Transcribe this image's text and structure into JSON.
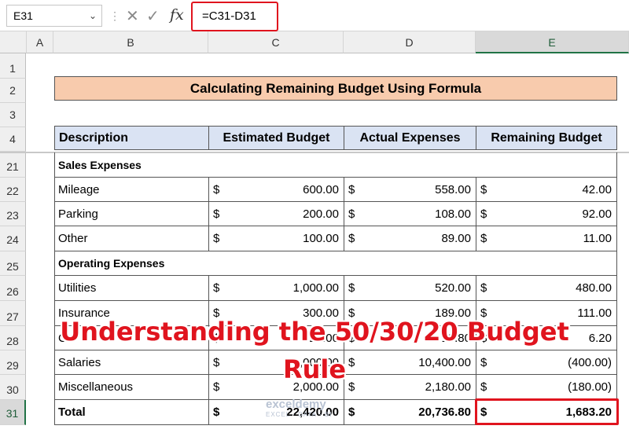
{
  "formula_bar": {
    "name_box": "E31",
    "formula": "=C31-D31",
    "fx_label": "fx"
  },
  "columns": [
    "A",
    "B",
    "C",
    "D",
    "E"
  ],
  "row_numbers": [
    "1",
    "2",
    "3",
    "4",
    "21",
    "22",
    "23",
    "24",
    "25",
    "26",
    "27",
    "28",
    "29",
    "30",
    "31"
  ],
  "sheet": {
    "title": "Calculating Remaining Budget Using Formula",
    "headers": [
      "Description",
      "Estimated Budget",
      "Actual Expenses",
      "Remaining Budget"
    ],
    "rows": [
      {
        "label": "Sales Expenses",
        "section": true
      },
      {
        "label": "Mileage",
        "est": "600.00",
        "act": "558.00",
        "rem": "42.00"
      },
      {
        "label": "Parking",
        "est": "200.00",
        "act": "108.00",
        "rem": "92.00"
      },
      {
        "label": "Other",
        "est": "100.00",
        "act": "89.00",
        "rem": "11.00"
      },
      {
        "label": "Operating Expenses",
        "section": true
      },
      {
        "label": "Utilities",
        "est": "1,000.00",
        "act": "520.00",
        "rem": "480.00"
      },
      {
        "label": "Insurance",
        "est": "300.00",
        "act": "189.00",
        "rem": "111.00"
      },
      {
        "label": "Cl",
        "est": "20.00",
        "act": "13.80",
        "rem": "6.20"
      },
      {
        "label": "Salaries",
        "est": "0,000.00",
        "act": "10,400.00",
        "rem": "(400.00)"
      },
      {
        "label": "Miscellaneous",
        "est": "2,000.00",
        "act": "2,180.00",
        "rem": "(180.00)"
      },
      {
        "label": "Total",
        "est": "22,420.00",
        "act": "20,736.80",
        "rem": "1,683.20",
        "total": true
      }
    ],
    "currency": "$"
  },
  "overlay_text": [
    "Understanding the 50/30/20 Budget",
    "Rule"
  ],
  "watermark": {
    "brand": "exceldemy",
    "tagline": "EXCEL · DATA · BI"
  },
  "colors": {
    "accent_red": "#e0141e",
    "title_fill": "#f8cbad",
    "header_fill": "#dae3f3",
    "excel_green": "#217346"
  }
}
